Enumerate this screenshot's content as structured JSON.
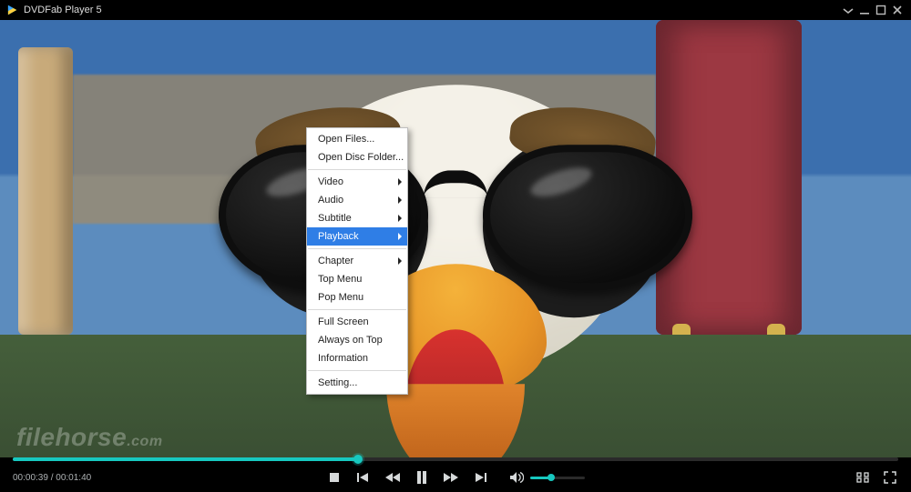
{
  "titlebar": {
    "app_title": "DVDFab Player 5"
  },
  "context_menu": {
    "items": [
      {
        "label": "Open Files...",
        "submenu": false,
        "sep_after": false,
        "highlighted": false
      },
      {
        "label": "Open Disc Folder...",
        "submenu": false,
        "sep_after": true,
        "highlighted": false
      },
      {
        "label": "Video",
        "submenu": true,
        "sep_after": false,
        "highlighted": false
      },
      {
        "label": "Audio",
        "submenu": true,
        "sep_after": false,
        "highlighted": false
      },
      {
        "label": "Subtitle",
        "submenu": true,
        "sep_after": false,
        "highlighted": false
      },
      {
        "label": "Playback",
        "submenu": true,
        "sep_after": true,
        "highlighted": true
      },
      {
        "label": "Chapter",
        "submenu": true,
        "sep_after": false,
        "highlighted": false
      },
      {
        "label": "Top Menu",
        "submenu": false,
        "sep_after": false,
        "highlighted": false
      },
      {
        "label": "Pop Menu",
        "submenu": false,
        "sep_after": true,
        "highlighted": false
      },
      {
        "label": "Full Screen",
        "submenu": false,
        "sep_after": false,
        "highlighted": false
      },
      {
        "label": "Always on Top",
        "submenu": false,
        "sep_after": false,
        "highlighted": false
      },
      {
        "label": "Information",
        "submenu": false,
        "sep_after": true,
        "highlighted": false
      },
      {
        "label": "Setting...",
        "submenu": false,
        "sep_after": false,
        "highlighted": false
      }
    ]
  },
  "playback": {
    "current_time": "00:00:39",
    "total_time": "00:01:40",
    "time_separator": " / ",
    "progress_percent": 39,
    "volume_percent": 38
  },
  "watermark": {
    "brand": "filehorse",
    "tld": ".com"
  },
  "colors": {
    "accent": "#17c8bf"
  }
}
